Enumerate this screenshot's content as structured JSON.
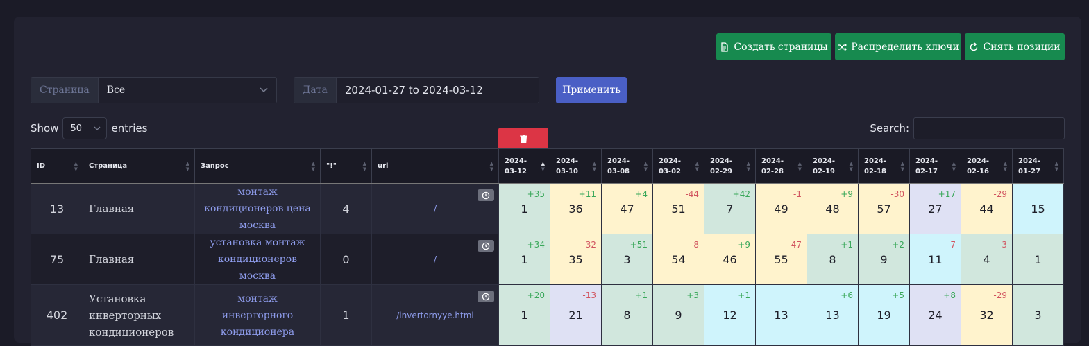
{
  "toolbar": {
    "create_pages": "Создать страницы",
    "distribute_keys": "Распределить ключи",
    "take_positions": "Снять позиции"
  },
  "filters": {
    "page_label": "Страница",
    "page_value": "Все",
    "date_label": "Дата",
    "date_value": "2024-01-27 to 2024-03-12",
    "apply": "Применить"
  },
  "table_controls": {
    "show": "Show",
    "entries_value": "50",
    "entries": "entries",
    "search": "Search:"
  },
  "columns": [
    "ID",
    "Страница",
    "Запрос",
    "\"!\"",
    "url"
  ],
  "date_columns": [
    "2024-03-12",
    "2024-03-10",
    "2024-03-08",
    "2024-03-02",
    "2024-02-29",
    "2024-02-28",
    "2024-02-19",
    "2024-02-18",
    "2024-02-17",
    "2024-02-16",
    "2024-01-27"
  ],
  "rows": [
    {
      "id": "13",
      "page": "Главная",
      "query": "монтаж кондиционеров цена москва",
      "excl": "4",
      "url": "/",
      "positions": [
        {
          "v": "1",
          "d": "+35",
          "c": "green"
        },
        {
          "v": "36",
          "d": "+11",
          "c": "yellow"
        },
        {
          "v": "47",
          "d": "+4",
          "c": "yellow"
        },
        {
          "v": "51",
          "d": "-44",
          "c": "yellow"
        },
        {
          "v": "7",
          "d": "+42",
          "c": "green"
        },
        {
          "v": "49",
          "d": "-1",
          "c": "yellow"
        },
        {
          "v": "48",
          "d": "+9",
          "c": "yellow"
        },
        {
          "v": "57",
          "d": "-30",
          "c": "yellow"
        },
        {
          "v": "27",
          "d": "+17",
          "c": "lav"
        },
        {
          "v": "44",
          "d": "-29",
          "c": "yellow"
        },
        {
          "v": "15",
          "d": "",
          "c": "cyan"
        }
      ]
    },
    {
      "id": "75",
      "page": "Главная",
      "query": "установка монтаж кондиционеров москва",
      "excl": "0",
      "url": "/",
      "positions": [
        {
          "v": "1",
          "d": "+34",
          "c": "green"
        },
        {
          "v": "35",
          "d": "-32",
          "c": "yellow"
        },
        {
          "v": "3",
          "d": "+51",
          "c": "green"
        },
        {
          "v": "54",
          "d": "-8",
          "c": "yellow"
        },
        {
          "v": "46",
          "d": "+9",
          "c": "yellow"
        },
        {
          "v": "55",
          "d": "-47",
          "c": "yellow"
        },
        {
          "v": "8",
          "d": "+1",
          "c": "green"
        },
        {
          "v": "9",
          "d": "+2",
          "c": "green"
        },
        {
          "v": "11",
          "d": "-7",
          "c": "cyan"
        },
        {
          "v": "4",
          "d": "-3",
          "c": "green"
        },
        {
          "v": "1",
          "d": "",
          "c": "green"
        }
      ]
    },
    {
      "id": "402",
      "page": "Установка инверторных кондиционеров",
      "query": "монтаж инверторного кондиционера",
      "excl": "1",
      "url": "/invertornyye.html",
      "positions": [
        {
          "v": "1",
          "d": "+20",
          "c": "green"
        },
        {
          "v": "21",
          "d": "-13",
          "c": "lav"
        },
        {
          "v": "8",
          "d": "+1",
          "c": "green"
        },
        {
          "v": "9",
          "d": "+3",
          "c": "green"
        },
        {
          "v": "12",
          "d": "+1",
          "c": "cyan"
        },
        {
          "v": "13",
          "d": "",
          "c": "cyan"
        },
        {
          "v": "13",
          "d": "+6",
          "c": "cyan"
        },
        {
          "v": "19",
          "d": "+5",
          "c": "cyan"
        },
        {
          "v": "24",
          "d": "+8",
          "c": "lav"
        },
        {
          "v": "32",
          "d": "-29",
          "c": "yellow"
        },
        {
          "v": "3",
          "d": "",
          "c": "green"
        }
      ]
    }
  ]
}
